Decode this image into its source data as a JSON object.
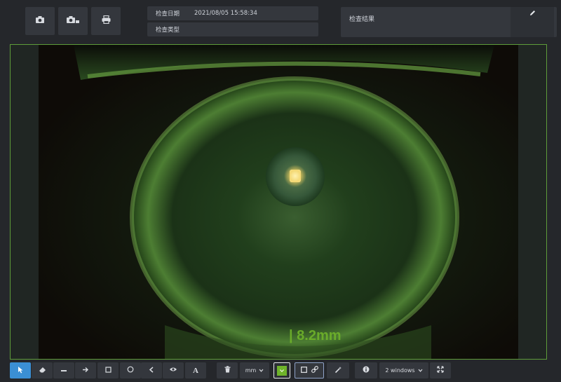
{
  "header": {
    "exam_date_label": "检查日期",
    "exam_date_value": "2021/08/05 15:58:34",
    "exam_type_label": "检查类型",
    "exam_type_value": "",
    "result_label": "检查结果"
  },
  "image": {
    "measurement_text": "| 8.2mm"
  },
  "toolbar": {
    "unit_value": "mm",
    "windows_value": "2 windows"
  },
  "colors": {
    "accent": "#3b8fd4",
    "annotation_green": "#6fb32a",
    "viewport_border": "#5e9c3a"
  },
  "icons": [
    "camera-icon",
    "camera-video-icon",
    "printer-icon",
    "edit-icon",
    "pointer-icon",
    "eraser-icon",
    "line-icon",
    "arrow-icon",
    "rectangle-icon",
    "circle-icon",
    "angle-icon",
    "eye-icon",
    "text-icon",
    "trash-icon",
    "chevron-down-icon",
    "link-icon",
    "magic-wand-icon",
    "info-icon",
    "fullscreen-icon"
  ]
}
